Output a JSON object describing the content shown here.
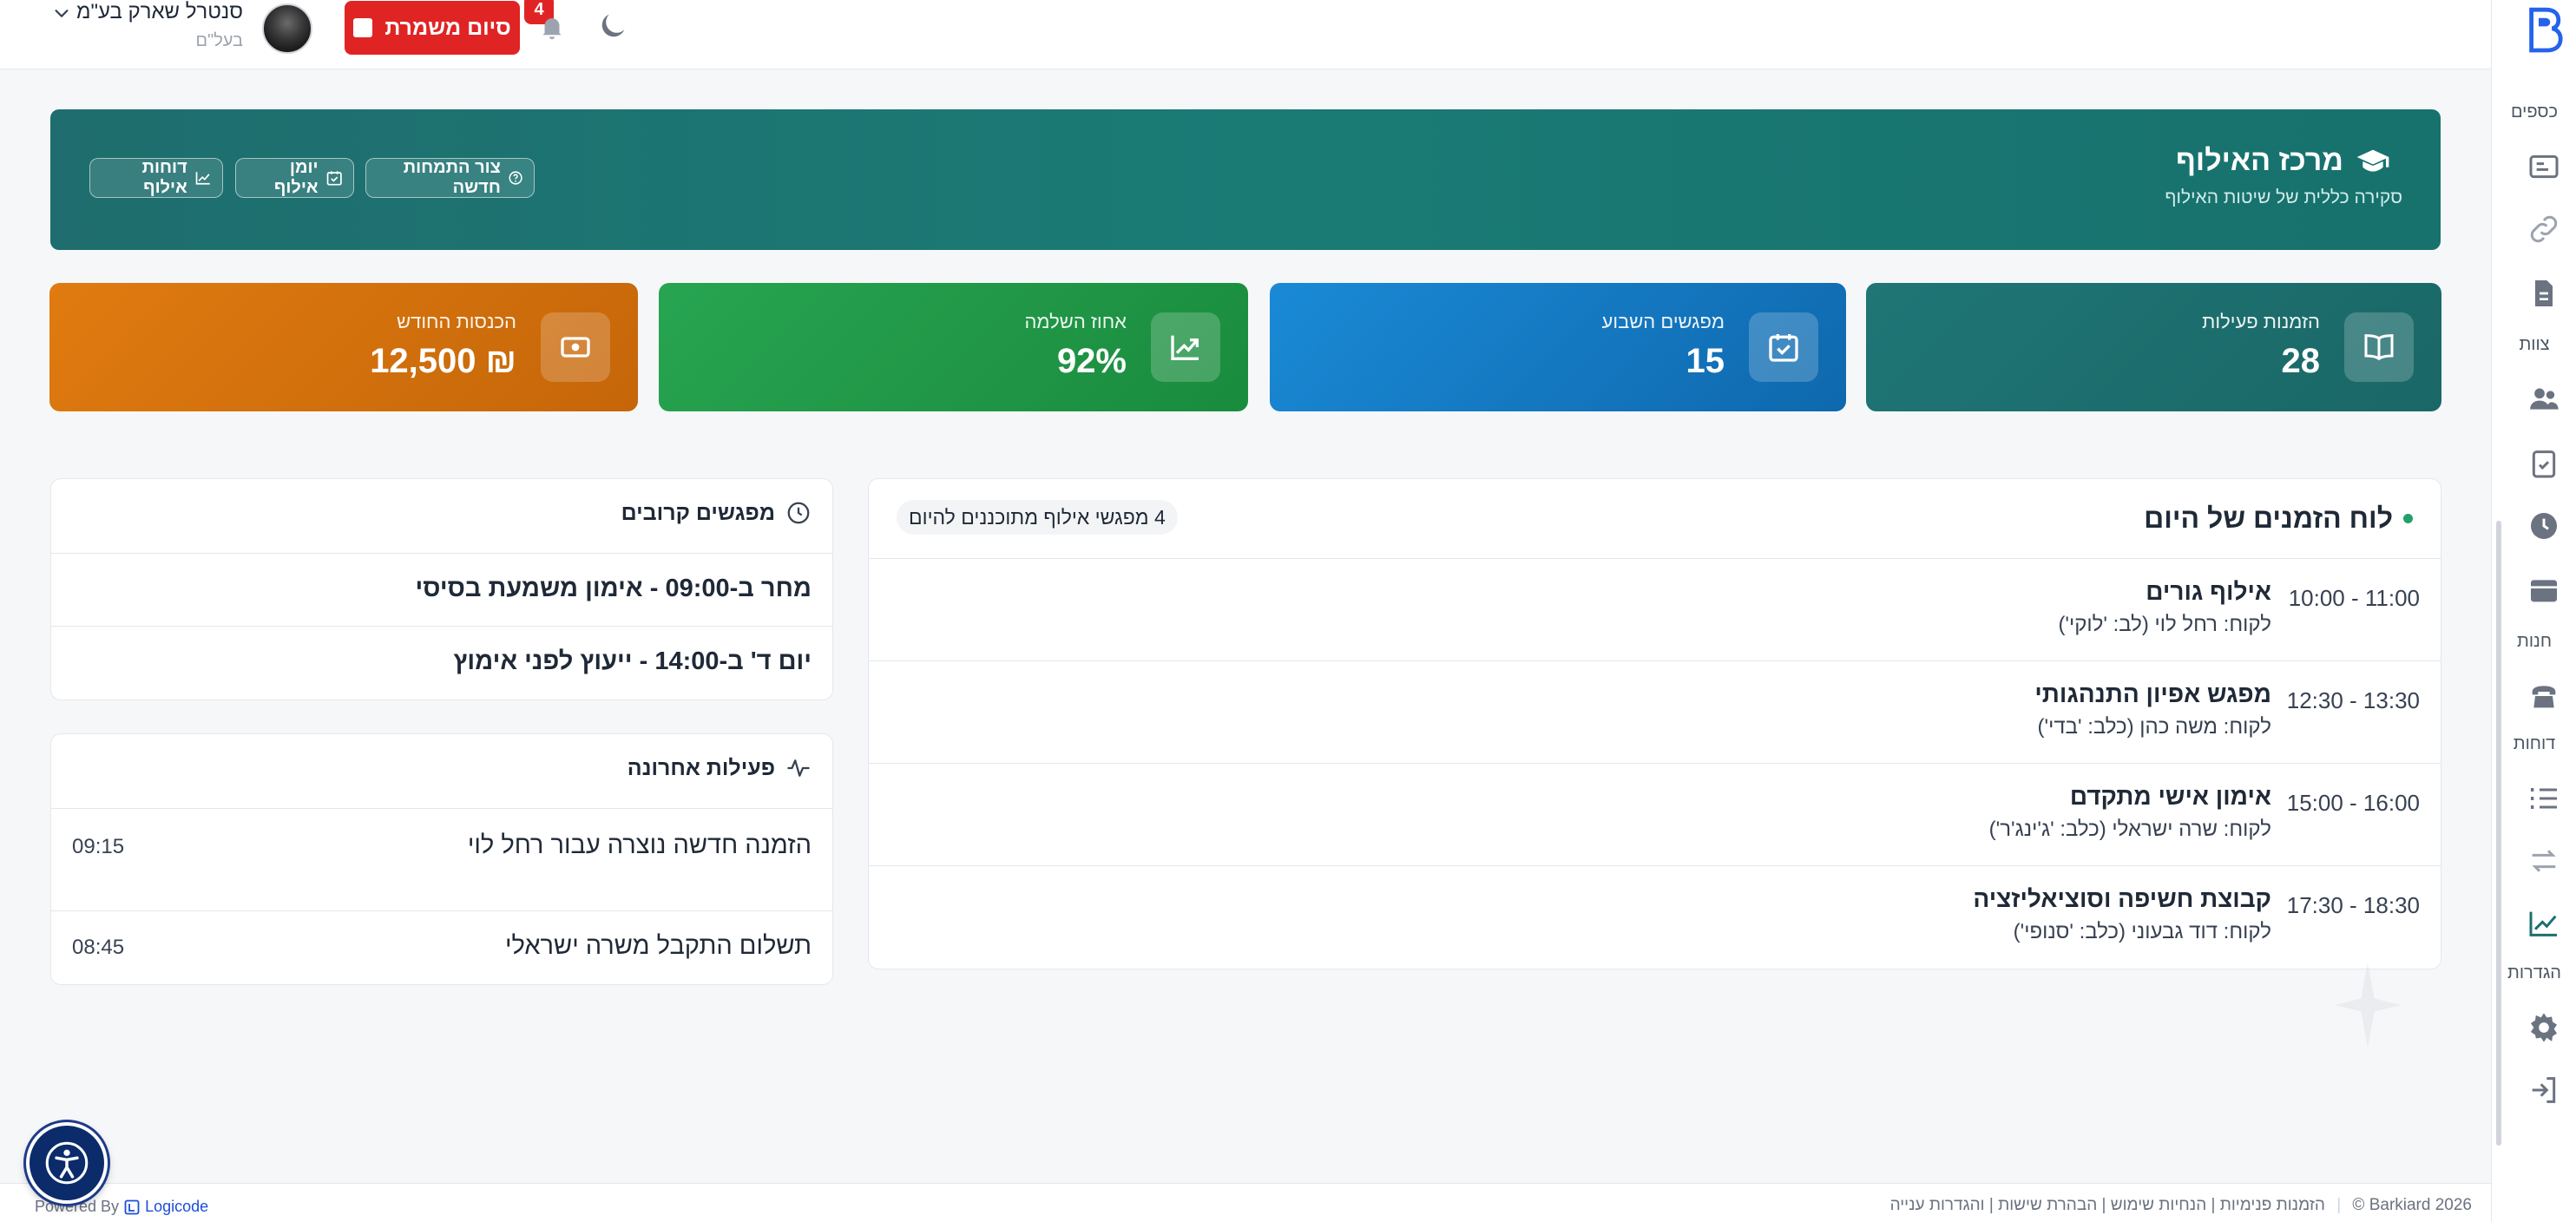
{
  "topbar": {
    "user_name": "סנטרל שארק בע\"מ",
    "user_role": "בעל\"ם",
    "end_shift_label": "סיום משמרת",
    "notifications_count": "4"
  },
  "sidebar": {
    "labels": [
      "כספים",
      "צוות",
      "חנות",
      "דוחות",
      "הגדרות"
    ]
  },
  "hero": {
    "title": "מרכז האילוף",
    "subtitle": "סקירה כללית של שיטות האילוף",
    "buttons": [
      {
        "label": "צור התמחות חדשה"
      },
      {
        "label": "יומן אילוף"
      },
      {
        "label": "דוחות אילוף"
      }
    ]
  },
  "stats": [
    {
      "label": "הזמנות פעילות",
      "value": "28",
      "color": "#1d6f6e"
    },
    {
      "label": "מפגשים השבוע",
      "value": "15",
      "color": "#1279c1"
    },
    {
      "label": "אחוז השלמה",
      "value": "92%",
      "color": "#1f9a47"
    },
    {
      "label": "הכנסות החודש",
      "value": "₪ 12,500",
      "color": "#d46d0b"
    }
  ],
  "schedule": {
    "title": "לוח הזמנים של היום",
    "badge": "4 מפגשי אילוף מתוכננים להיום",
    "rows": [
      {
        "time": "10:00 - 11:00",
        "title": "אילוף גורים",
        "client": "לקוח: רחל לוי (לב: 'לוקי')"
      },
      {
        "time": "12:30 - 13:30",
        "title": "מפגש אפיון התנהגותי",
        "client": "לקוח: משה כהן (כלב: 'בדי')"
      },
      {
        "time": "15:00 - 16:00",
        "title": "אימון אישי מתקדם",
        "client": "לקוח: שרה ישראלי (כלב: 'ג'ינג'ר')"
      },
      {
        "time": "17:30 - 18:30",
        "title": "קבוצת חשיפה וסוציאליזציה",
        "client": "לקוח: דוד גבעוני (כלב: 'סנופי')"
      }
    ]
  },
  "upcoming": {
    "title": "מפגשים קרובים",
    "rows": [
      {
        "text": "מחר ב-09:00 - אימון משמעת בסיסי"
      },
      {
        "text": "יום ד' ב-14:00 - ייעוץ לפני אימוץ"
      }
    ]
  },
  "activity": {
    "title": "פעילות אחרונה",
    "rows": [
      {
        "text": "הזמנה חדשה נוצרה עבור רחל לוי",
        "time": "09:15"
      },
      {
        "text": "תשלום התקבל משרה ישראלי",
        "time": "08:45"
      }
    ]
  },
  "footer": {
    "copyright": "© Barkiard 2026",
    "links": "הזמנות פנימיות | הנחיות שימוש | הבהרת שישות | והגדרות ענייה",
    "powered_by": "Powered By",
    "brand": "Logicode"
  },
  "colors": {
    "primary_teal": "#1d6f6e",
    "danger": "#e02424",
    "blue": "#1279c1",
    "green": "#1f9a47",
    "orange": "#d46d0b"
  }
}
